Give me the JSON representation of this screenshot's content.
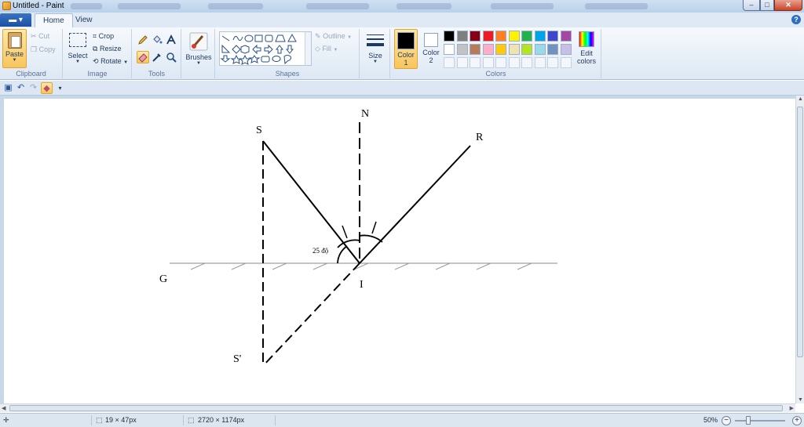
{
  "window": {
    "title": "Untitled - Paint",
    "controls": {
      "minimize": "–",
      "maximize": "□",
      "close": "✕"
    }
  },
  "tabs": {
    "app_menu": "▾",
    "home": "Home",
    "view": "View",
    "help": "?"
  },
  "ribbon": {
    "clipboard": {
      "label": "Clipboard",
      "paste": "Paste",
      "cut": "Cut",
      "copy": "Copy"
    },
    "image": {
      "label": "Image",
      "select": "Select",
      "crop": "Crop",
      "resize": "Resize",
      "rotate": "Rotate"
    },
    "tools": {
      "label": "Tools",
      "items": [
        "pencil-icon",
        "fill-icon",
        "text-icon",
        "eraser-icon",
        "color-picker-icon",
        "magnifier-icon"
      ],
      "selected": "eraser-icon"
    },
    "brushes": {
      "label": "Brushes"
    },
    "shapes": {
      "label": "Shapes",
      "outline": "Outline",
      "fill": "Fill"
    },
    "size": {
      "label": "Size"
    },
    "colors": {
      "label": "Colors",
      "color1_label": "Color",
      "color1_num": "1",
      "color2_label": "Color",
      "color2_num": "2",
      "color1_value": "#000000",
      "color2_value": "#ffffff",
      "edit_label_1": "Edit",
      "edit_label_2": "colors",
      "palette_row1": [
        "#000000",
        "#7f7f7f",
        "#880015",
        "#ed1c24",
        "#ff7f27",
        "#fff200",
        "#22b14c",
        "#00a2e8",
        "#3f48cc",
        "#a349a4"
      ],
      "palette_row2": [
        "#ffffff",
        "#c3c3c3",
        "#b97a57",
        "#ffaec9",
        "#ffc90e",
        "#efe4b0",
        "#b5e61d",
        "#99d9ea",
        "#7092be",
        "#c8bfe7"
      ]
    }
  },
  "quick_access": [
    "save-icon",
    "undo-icon",
    "redo-icon",
    "eraser-icon",
    "customize-icon"
  ],
  "canvas_labels": {
    "S": "S",
    "N": "N",
    "R": "R",
    "G": "G",
    "I": "I",
    "S_prime": "S'",
    "angle": "25 độ"
  },
  "status": {
    "selection_size": "19 × 47px",
    "image_size": "2720 × 1174px",
    "zoom": "50%"
  }
}
